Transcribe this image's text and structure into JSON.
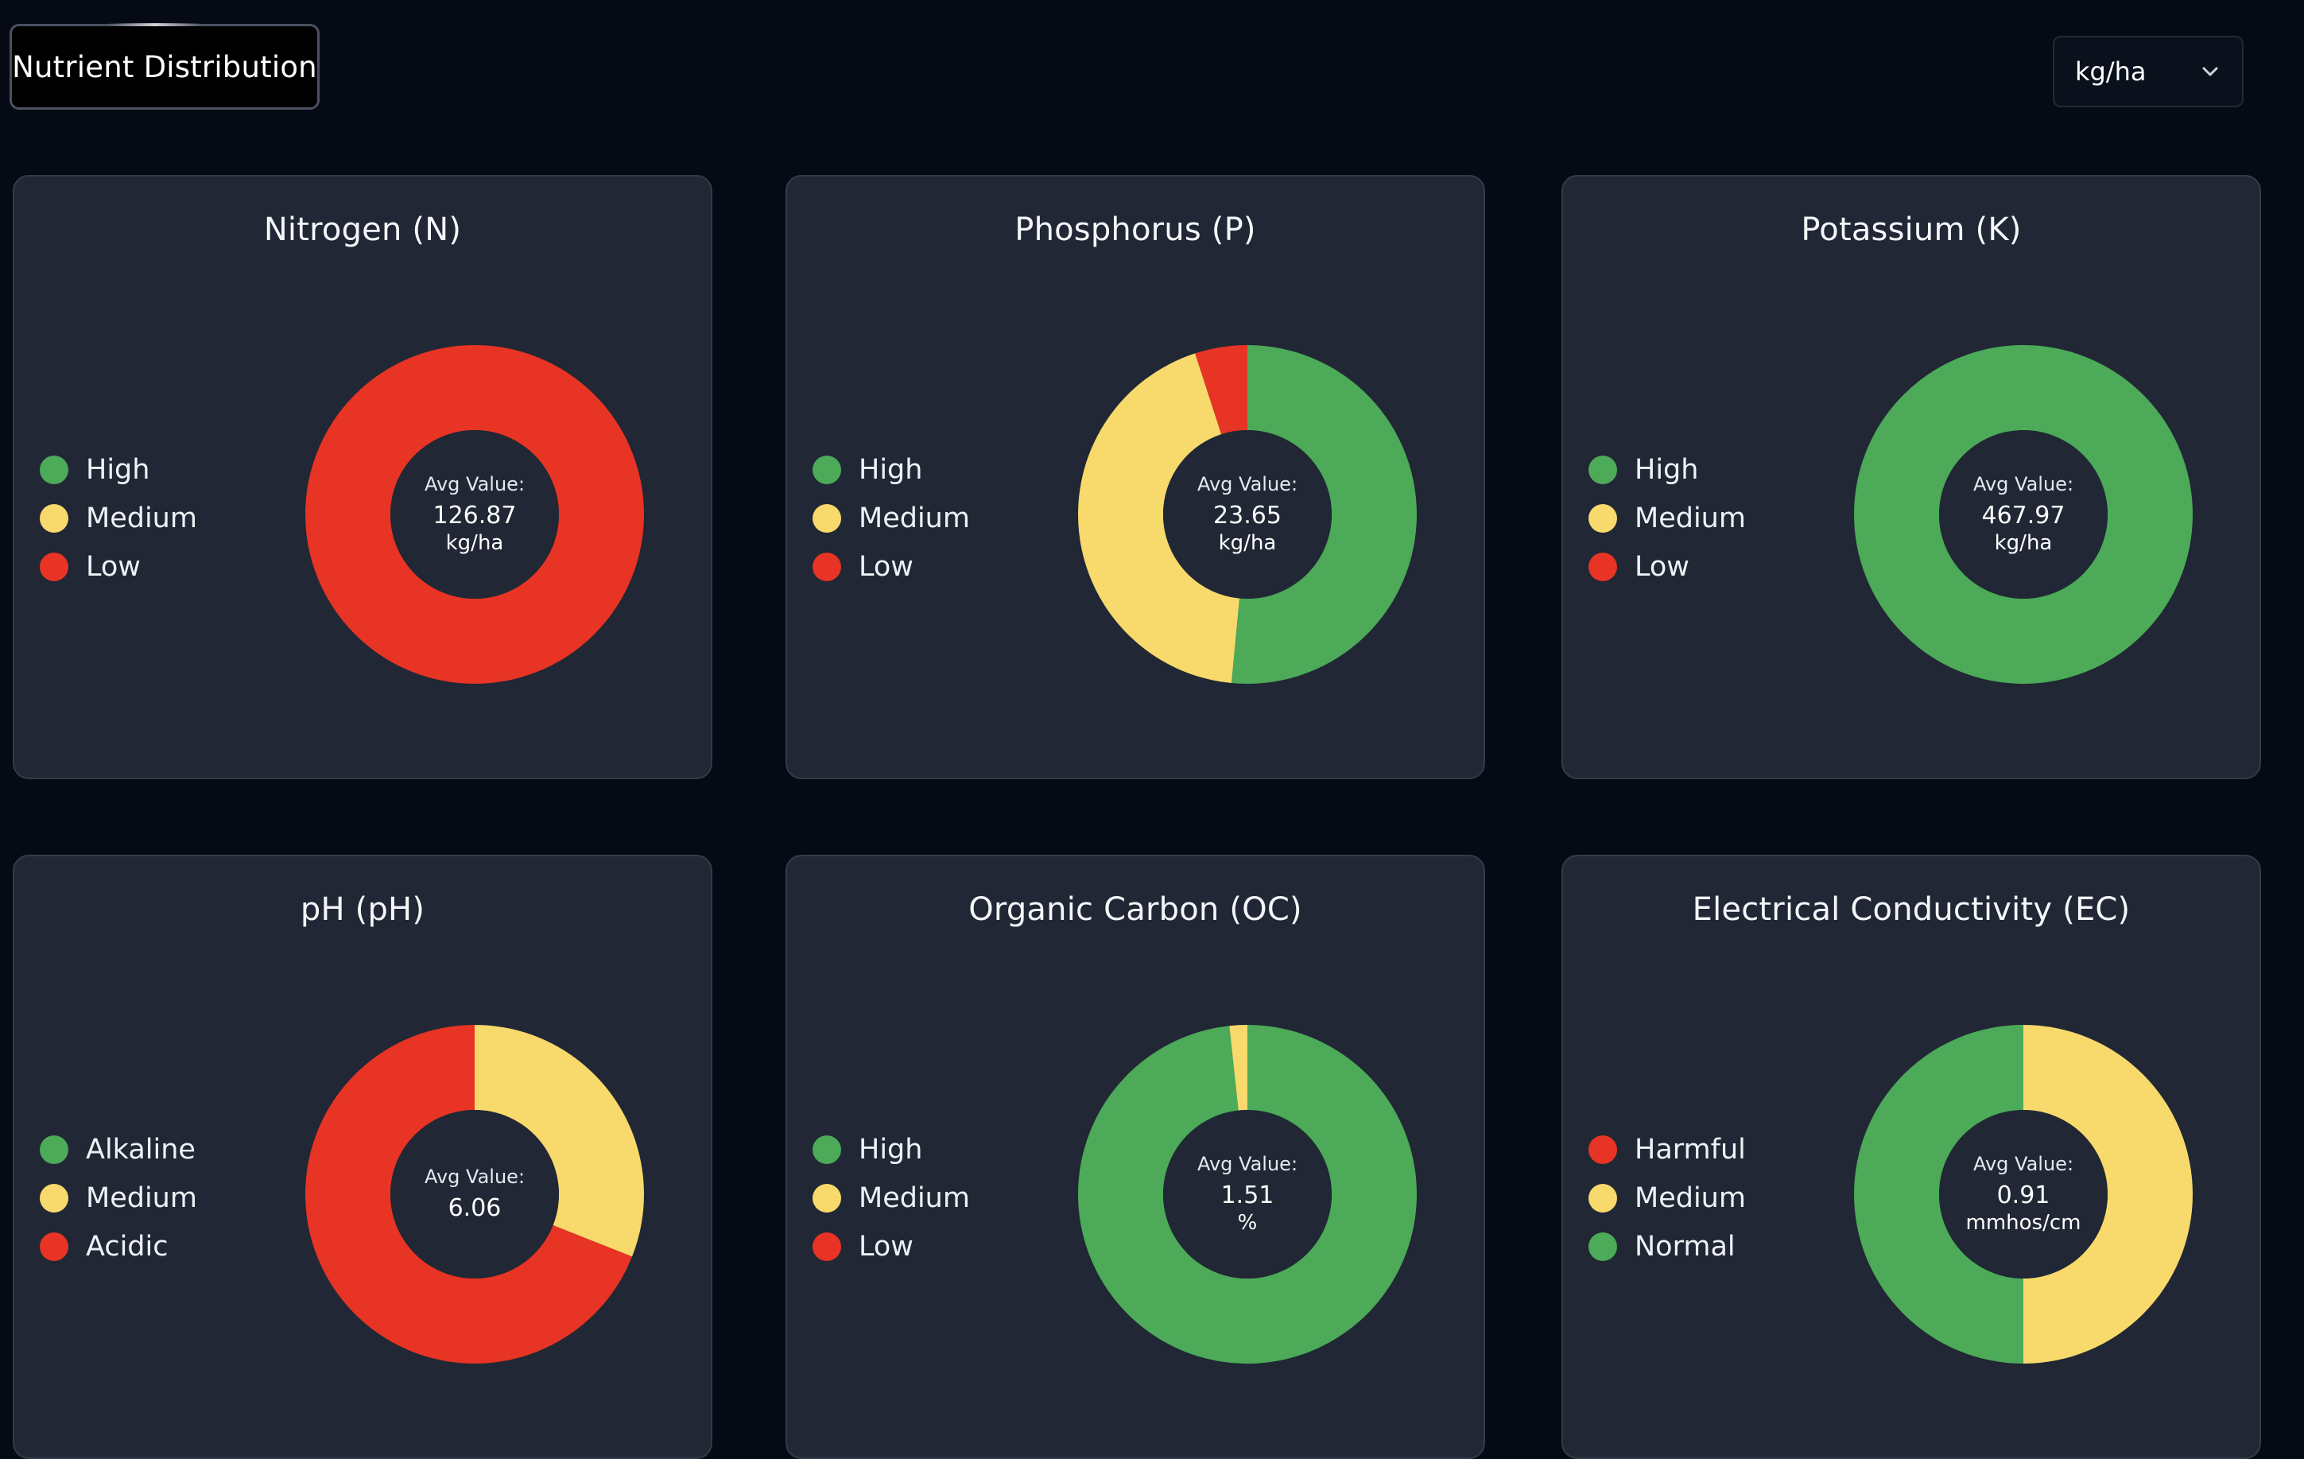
{
  "header": {
    "tab_label": "Nutrient Distribution",
    "unit_select": {
      "value": "kg/ha",
      "icon": "chevron-down-icon"
    }
  },
  "colors": {
    "green": "#4caa58",
    "yellow": "#f7d96c",
    "red": "#e73424",
    "card_bg": "#212734",
    "hole_bg": "#212734"
  },
  "center_prefix": "Avg Value:",
  "cards": [
    {
      "title": "Nitrogen (N)",
      "legend": [
        {
          "label": "High",
          "color": "#4caa58"
        },
        {
          "label": "Medium",
          "color": "#f7d96c"
        },
        {
          "label": "Low",
          "color": "#e73424"
        }
      ],
      "avg_value": "126.87",
      "unit": "kg/ha",
      "chart_data": {
        "type": "pie",
        "categories": [
          "High",
          "Medium",
          "Low"
        ],
        "values": [
          0,
          0,
          100
        ],
        "colors": [
          "#4caa58",
          "#f7d96c",
          "#e73424"
        ]
      }
    },
    {
      "title": "Phosphorus (P)",
      "legend": [
        {
          "label": "High",
          "color": "#4caa58"
        },
        {
          "label": "Medium",
          "color": "#f7d96c"
        },
        {
          "label": "Low",
          "color": "#e73424"
        }
      ],
      "avg_value": "23.65",
      "unit": "kg/ha",
      "chart_data": {
        "type": "pie",
        "categories": [
          "High",
          "Medium",
          "Low"
        ],
        "values": [
          51.5,
          43.5,
          5
        ],
        "colors": [
          "#4caa58",
          "#f7d96c",
          "#e73424"
        ]
      }
    },
    {
      "title": "Potassium (K)",
      "legend": [
        {
          "label": "High",
          "color": "#4caa58"
        },
        {
          "label": "Medium",
          "color": "#f7d96c"
        },
        {
          "label": "Low",
          "color": "#e73424"
        }
      ],
      "avg_value": "467.97",
      "unit": "kg/ha",
      "chart_data": {
        "type": "pie",
        "categories": [
          "High",
          "Medium",
          "Low"
        ],
        "values": [
          100,
          0,
          0
        ],
        "colors": [
          "#4caa58",
          "#f7d96c",
          "#e73424"
        ]
      }
    },
    {
      "title": "pH (pH)",
      "legend": [
        {
          "label": "Alkaline",
          "color": "#4caa58"
        },
        {
          "label": "Medium",
          "color": "#f7d96c"
        },
        {
          "label": "Acidic",
          "color": "#e73424"
        }
      ],
      "avg_value": "6.06",
      "unit": "",
      "chart_data": {
        "type": "pie",
        "categories": [
          "Alkaline",
          "Medium",
          "Acidic"
        ],
        "values": [
          0,
          31,
          69
        ],
        "colors": [
          "#4caa58",
          "#f7d96c",
          "#e73424"
        ]
      }
    },
    {
      "title": "Organic Carbon (OC)",
      "legend": [
        {
          "label": "High",
          "color": "#4caa58"
        },
        {
          "label": "Medium",
          "color": "#f7d96c"
        },
        {
          "label": "Low",
          "color": "#e73424"
        }
      ],
      "avg_value": "1.51",
      "unit": "%",
      "chart_data": {
        "type": "pie",
        "categories": [
          "High",
          "Medium",
          "Low"
        ],
        "values": [
          98.3,
          1.7,
          0
        ],
        "colors": [
          "#4caa58",
          "#f7d96c",
          "#e73424"
        ]
      }
    },
    {
      "title": "Electrical Conductivity (EC)",
      "legend": [
        {
          "label": "Harmful",
          "color": "#e73424"
        },
        {
          "label": "Medium",
          "color": "#f7d96c"
        },
        {
          "label": "Normal",
          "color": "#4caa58"
        }
      ],
      "avg_value": "0.91",
      "unit": "mmhos/cm",
      "chart_data": {
        "type": "pie",
        "categories": [
          "Harmful",
          "Medium",
          "Normal"
        ],
        "values": [
          0,
          50,
          50
        ],
        "colors": [
          "#e73424",
          "#f7d96c",
          "#4caa58"
        ]
      }
    }
  ]
}
